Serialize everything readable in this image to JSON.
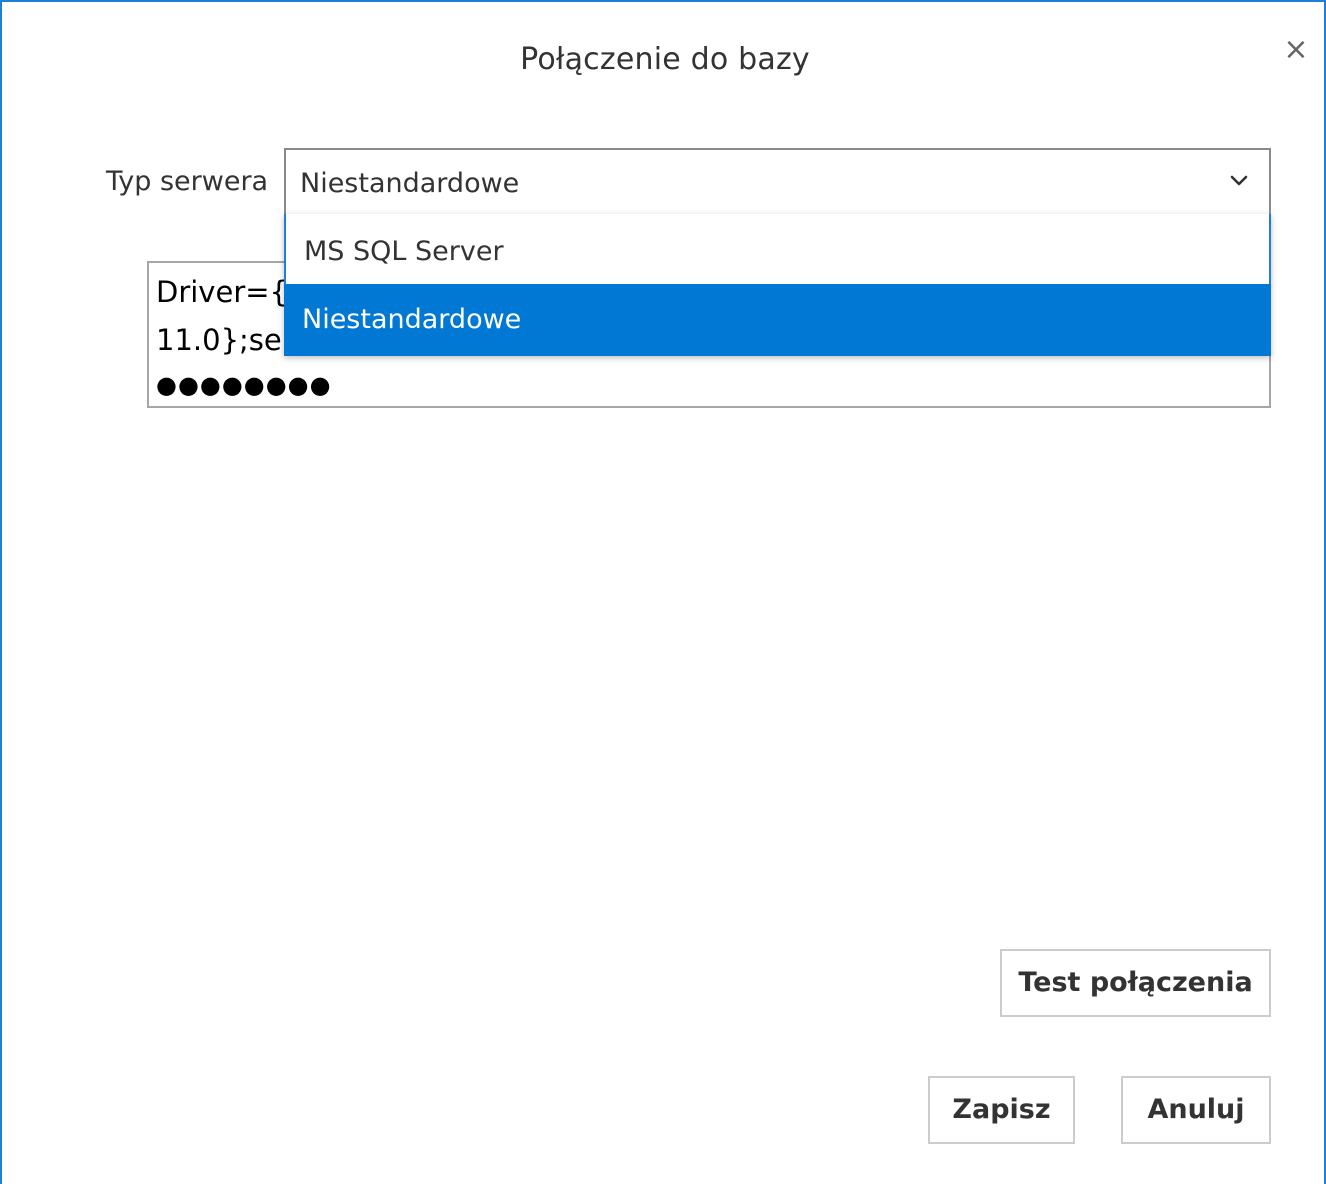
{
  "dialog": {
    "title": "Połączenie do bazy",
    "close_icon": "close-icon",
    "close_glyph": "×"
  },
  "server_type": {
    "label": "Typ serwera",
    "selected": "Niestandardowe",
    "options": [
      "MS SQL Server",
      "Niestandardowe"
    ],
    "highlighted_index": 1
  },
  "connection_string": {
    "line1": "Driver={",
    "line2": "11.0};ser",
    "password_mask": "●●●●●●●●"
  },
  "buttons": {
    "test": "Test połączenia",
    "save": "Zapisz",
    "cancel": "Anuluj"
  },
  "colors": {
    "accent": "#0078d4",
    "border": "#1e7fd6"
  }
}
